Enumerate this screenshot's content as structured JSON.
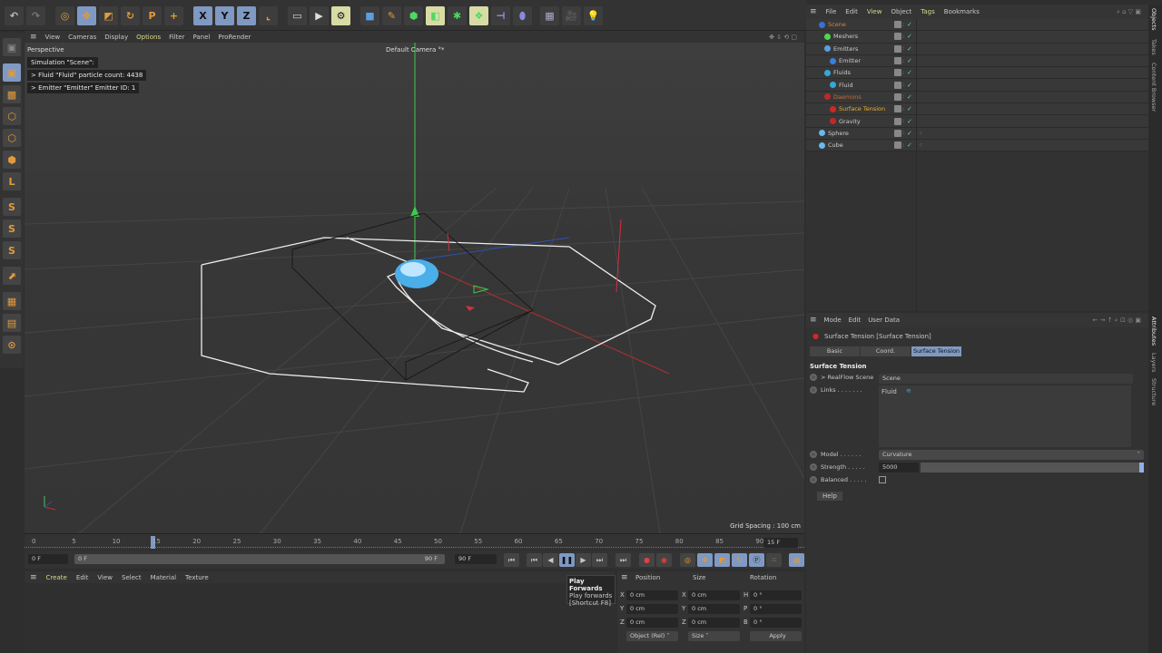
{
  "toolbar": {
    "icons": [
      {
        "name": "undo-icon",
        "g": "↶",
        "c": "#bbb",
        "s": ""
      },
      {
        "name": "redo-icon",
        "g": "↷",
        "c": "#777",
        "s": ""
      },
      {
        "name": "select-tool-icon",
        "g": "◎",
        "c": "#e39a3a",
        "s": ""
      },
      {
        "name": "move-tool-icon",
        "g": "✥",
        "c": "#e39a3a",
        "s": "on"
      },
      {
        "name": "scale-tool-icon",
        "g": "◩",
        "c": "#e39a3a",
        "s": ""
      },
      {
        "name": "rotate-tool-icon",
        "g": "↻",
        "c": "#e39a3a",
        "s": ""
      },
      {
        "name": "psr-icon",
        "g": "P",
        "c": "#e39a3a",
        "s": ""
      },
      {
        "name": "add-icon",
        "g": "+",
        "c": "#e39a3a",
        "s": ""
      },
      {
        "name": "x-axis-icon",
        "g": "X",
        "c": "#111",
        "s": "on"
      },
      {
        "name": "y-axis-icon",
        "g": "Y",
        "c": "#111",
        "s": "on"
      },
      {
        "name": "z-axis-icon",
        "g": "Z",
        "c": "#111",
        "s": "on"
      },
      {
        "name": "coordinate-system-icon",
        "g": "⌞",
        "c": "#e39a3a",
        "s": ""
      },
      {
        "name": "render-view-icon",
        "g": "▭",
        "c": "#ddd",
        "s": ""
      },
      {
        "name": "render-picture-viewer-icon",
        "g": "▶",
        "c": "#ddd",
        "s": ""
      },
      {
        "name": "render-settings-icon",
        "g": "⚙",
        "c": "#111",
        "s": "hl"
      },
      {
        "name": "cube-object-icon",
        "g": "■",
        "c": "#5aa0e0",
        "s": ""
      },
      {
        "name": "pen-icon",
        "g": "✎",
        "c": "#e39a3a",
        "s": ""
      },
      {
        "name": "subdivision-icon",
        "g": "⬢",
        "c": "#4cd964",
        "s": ""
      },
      {
        "name": "extrude-icon",
        "g": "◧",
        "c": "#4cd964",
        "s": "hl"
      },
      {
        "name": "mograph-icon",
        "g": "✱",
        "c": "#4cd964",
        "s": ""
      },
      {
        "name": "cloner-icon",
        "g": "❖",
        "c": "#4cd964",
        "s": "hl"
      },
      {
        "name": "deformer-icon",
        "g": "⊣",
        "c": "#b38cf0",
        "s": ""
      },
      {
        "name": "field-icon",
        "g": "⬮",
        "c": "#8a8ae0",
        "s": ""
      },
      {
        "name": "floor-icon",
        "g": "▦",
        "c": "#aac",
        "s": ""
      },
      {
        "name": "camera-icon",
        "g": "🎥",
        "c": "#ddd",
        "s": ""
      },
      {
        "name": "light-icon",
        "g": "💡",
        "c": "#eee",
        "s": ""
      }
    ]
  },
  "left_toolbar": {
    "icons": [
      {
        "name": "make-editable-icon",
        "g": "▣",
        "c": "#888"
      },
      {
        "name": "model-mode-icon",
        "g": "▣",
        "c": "#e39a3a"
      },
      {
        "name": "texture-mode-icon",
        "g": "▩",
        "c": "#e39a3a"
      },
      {
        "name": "points-mode-icon",
        "g": "⬡",
        "c": "#e39a3a"
      },
      {
        "name": "edges-mode-icon",
        "g": "⬡",
        "c": "#e39a3a"
      },
      {
        "name": "polygons-mode-icon",
        "g": "⬢",
        "c": "#e39a3a"
      },
      {
        "name": "axis-icon",
        "g": "L",
        "c": "#e39a3a"
      },
      {
        "name": "snap-icon",
        "g": "S",
        "c": "#e39a3a"
      },
      {
        "name": "snap-settings-icon",
        "g": "S",
        "c": "#e39a3a"
      },
      {
        "name": "workplane-icon",
        "g": "S",
        "c": "#e39a3a"
      },
      {
        "name": "tweak-icon",
        "g": "⬈",
        "c": "#e39a3a"
      },
      {
        "name": "grid-icon",
        "g": "▦",
        "c": "#e39a3a"
      },
      {
        "name": "lock-workplane-icon",
        "g": "▤",
        "c": "#e39a3a"
      },
      {
        "name": "paint-icon",
        "g": "⊙",
        "c": "#e39a3a"
      }
    ]
  },
  "viewport": {
    "menu": [
      "View",
      "Cameras",
      "Display",
      "Options",
      "Filter",
      "Panel",
      "ProRender"
    ],
    "label": "Perspective",
    "camera": "Default Camera °*",
    "hud": [
      "Simulation \"Scene\":",
      " > Fluid \"Fluid\" particle count: 4438",
      " > Emitter \"Emitter\" Emitter ID: 1"
    ],
    "grid_spacing": "Grid Spacing : 100 cm"
  },
  "timeline": {
    "ticks": [
      "0",
      "5",
      "10",
      "15",
      "20",
      "25",
      "30",
      "35",
      "40",
      "45",
      "50",
      "55",
      "60",
      "65",
      "70",
      "75",
      "80",
      "85",
      "90"
    ],
    "current_frame": "15 F",
    "start": "0 F",
    "range_start": "0 F",
    "range_end": "90 F",
    "end": "90 F"
  },
  "playback": {
    "buttons": [
      "go-to-start",
      "previous-key",
      "previous-frame",
      "play-forwards",
      "next-frame",
      "next-key",
      "go-to-end"
    ],
    "tooltip": {
      "title": "Play Forwards",
      "desc": "Play forwards",
      "shortcut": "[Shortcut F8]"
    }
  },
  "material_menu": [
    "Create",
    "Edit",
    "View",
    "Select",
    "Material",
    "Texture"
  ],
  "coords": {
    "headers": [
      "Position",
      "Size",
      "Rotation"
    ],
    "rows": [
      [
        "X",
        "0 cm",
        "X",
        "0 cm",
        "H",
        "0 °"
      ],
      [
        "Y",
        "0 cm",
        "Y",
        "0 cm",
        "P",
        "0 °"
      ],
      [
        "Z",
        "0 cm",
        "Z",
        "0 cm",
        "B",
        "0 °"
      ]
    ],
    "mode": "Object (Rel)",
    "size_mode": "Size",
    "apply": "Apply"
  },
  "objects": {
    "menu": [
      "File",
      "Edit",
      "View",
      "Object",
      "Tags",
      "Bookmarks"
    ],
    "items": [
      {
        "name": "Scene",
        "indent": 0,
        "color": "#d9823a",
        "icon": "#3a6fd8"
      },
      {
        "name": "Meshers",
        "indent": 1,
        "color": "#ccc",
        "icon": "#4cd94c"
      },
      {
        "name": "Emitters",
        "indent": 1,
        "color": "#ccc",
        "icon": "#5aa0e0"
      },
      {
        "name": "Emitter",
        "indent": 2,
        "color": "#ccc",
        "icon": "#3a7fd8"
      },
      {
        "name": "Fluids",
        "indent": 1,
        "color": "#ccc",
        "icon": "#36a8d8"
      },
      {
        "name": "Fluid",
        "indent": 2,
        "color": "#ccc",
        "icon": "#36a8d8"
      },
      {
        "name": "Daemons",
        "indent": 1,
        "color": "#c0703a",
        "icon": "#c02828"
      },
      {
        "name": "Surface Tension",
        "indent": 2,
        "color": "#f0b030",
        "icon": "#d02828"
      },
      {
        "name": "Gravity",
        "indent": 2,
        "color": "#ccc",
        "icon": "#c02828"
      },
      {
        "name": "Sphere",
        "indent": 0,
        "color": "#ccc",
        "icon": "#6ab8ee"
      },
      {
        "name": "Cube",
        "indent": 0,
        "color": "#ccc",
        "icon": "#6ab8ee"
      }
    ]
  },
  "side_tabs": [
    "Objects",
    "Takes",
    "Content Browser",
    "Attributes",
    "Layers",
    "Structure"
  ],
  "attributes": {
    "menu": [
      "Mode",
      "Edit",
      "User Data"
    ],
    "title": "Surface Tension [Surface Tension]",
    "tabs": [
      "Basic",
      "Coord.",
      "Surface Tension"
    ],
    "section": "Surface Tension",
    "realflow_label": "> RealFlow Scene",
    "realflow_value": "Scene",
    "links_label": "Links . . . . . . .",
    "links_value": "Fluid",
    "model_label": "Model . . . . . .",
    "model_value": "Curvature",
    "strength_label": "Strength . . . . .",
    "strength_value": "5000",
    "strength_fraction": 1.0,
    "balanced_label": "Balanced . . . . .",
    "balanced": false,
    "help": "Help"
  }
}
